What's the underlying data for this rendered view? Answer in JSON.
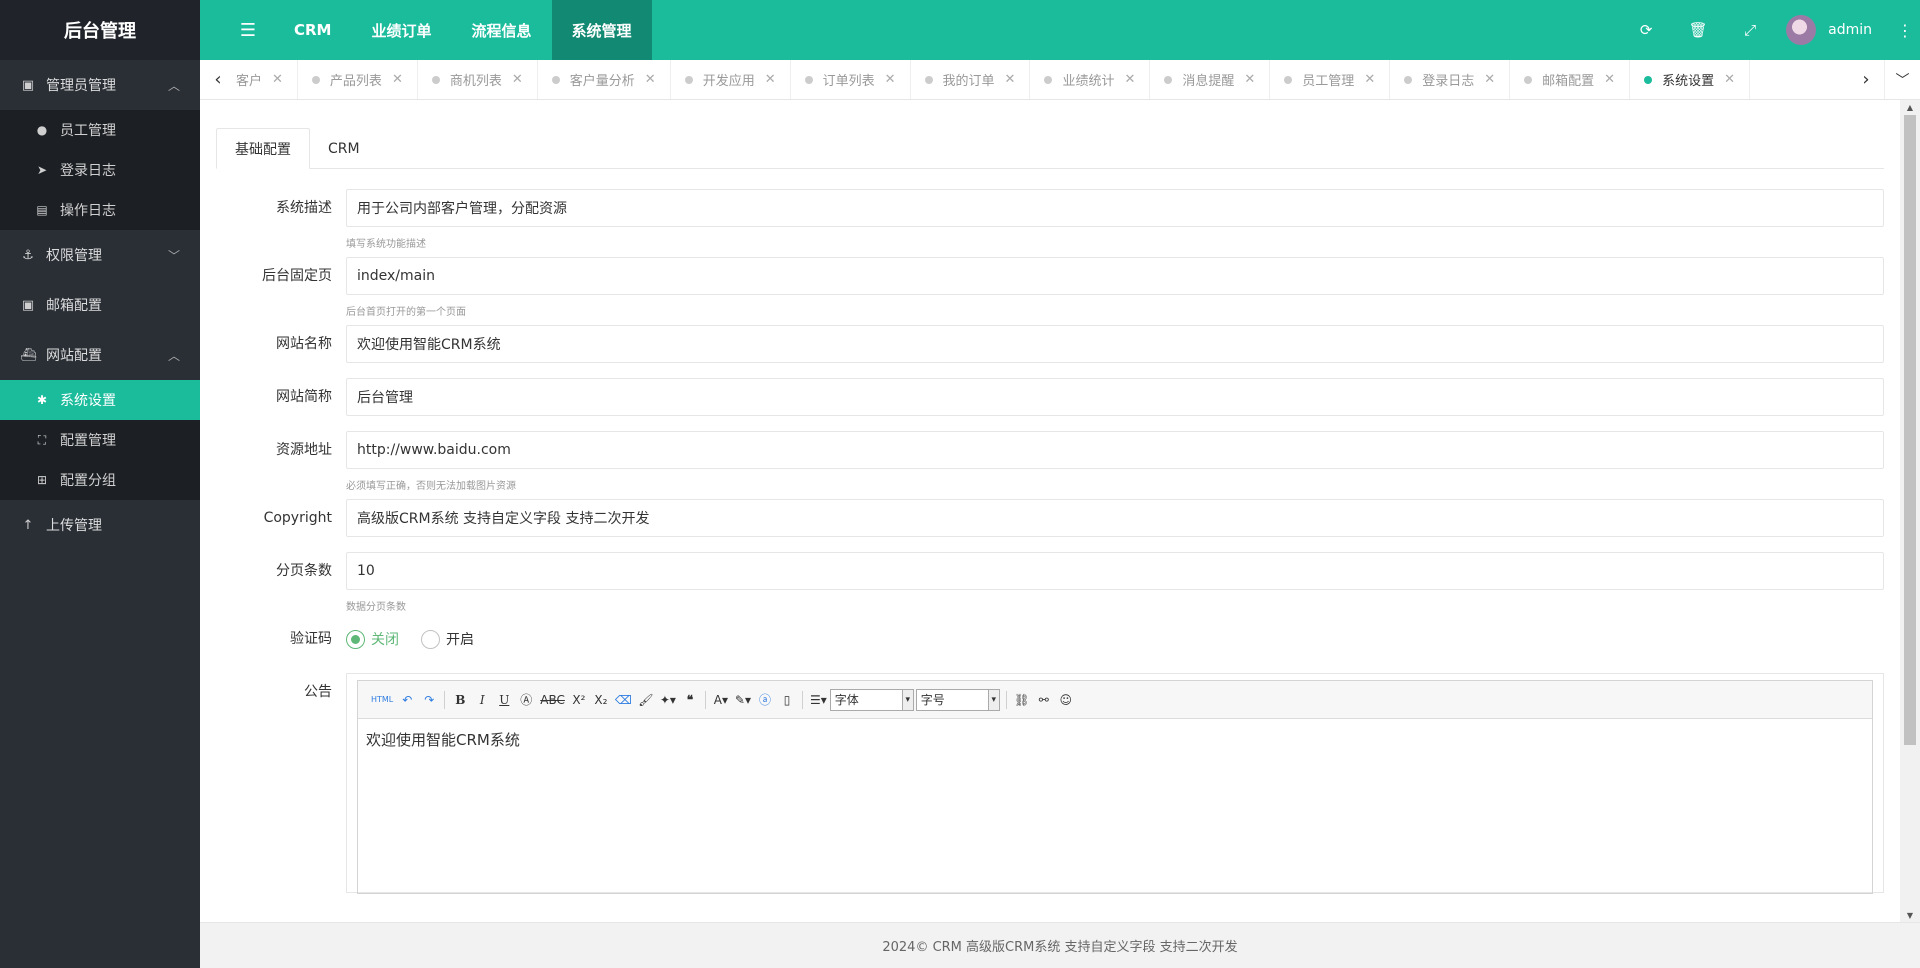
{
  "sidebar": {
    "logo": "后台管理",
    "groups": [
      {
        "label": "管理员管理",
        "icon": "admin-icon",
        "items": [
          {
            "label": "员工管理",
            "icon": "user-icon"
          },
          {
            "label": "登录日志",
            "icon": "paper-plane-icon"
          },
          {
            "label": "操作日志",
            "icon": "list-icon"
          }
        ]
      },
      {
        "label": "权限管理",
        "icon": "anchor-icon"
      },
      {
        "label": "邮箱配置",
        "icon": "mail-icon"
      },
      {
        "label": "网站配置",
        "icon": "ship-icon",
        "items": [
          {
            "label": "系统设置",
            "icon": "gear-icon",
            "active": true
          },
          {
            "label": "配置管理",
            "icon": "frame-icon"
          },
          {
            "label": "配置分组",
            "icon": "group-icon"
          }
        ]
      },
      {
        "label": "上传管理",
        "icon": "upload-icon"
      }
    ]
  },
  "topbar": {
    "nav": [
      "CRM",
      "业绩订单",
      "流程信息",
      "系统管理"
    ],
    "active_nav": "系统管理",
    "username": "admin"
  },
  "tabs": [
    "客户",
    "产品列表",
    "商机列表",
    "客户量分析",
    "开发应用",
    "订单列表",
    "我的订单",
    "业绩统计",
    "消息提醒",
    "员工管理",
    "登录日志",
    "邮箱配置",
    "系统设置"
  ],
  "active_tab": "系统设置",
  "form_tabs": [
    "基础配置",
    "CRM"
  ],
  "form": {
    "desc_label": "系统描述",
    "desc_value": "用于公司内部客户管理，分配资源",
    "desc_help": "填写系统功能描述",
    "home_label": "后台固定页",
    "home_value": "index/main",
    "home_help": "后台首页打开的第一个页面",
    "site_name_label": "网站名称",
    "site_name_value": "欢迎使用智能CRM系统",
    "short_name_label": "网站简称",
    "short_name_value": "后台管理",
    "resource_label": "资源地址",
    "resource_value": "http://www.baidu.com",
    "resource_help": "必须填写正确，否则无法加载图片资源",
    "copyright_label": "Copyright",
    "copyright_value": "高级版CRM系统 支持自定义字段  支持二次开发",
    "page_size_label": "分页条数",
    "page_size_value": "10",
    "page_size_help": "数据分页条数",
    "captcha_label": "验证码",
    "captcha_off": "关闭",
    "captcha_on": "开启",
    "captcha_selected": "关闭",
    "notice_label": "公告",
    "editor": {
      "font_select": "字体",
      "size_select": "字号",
      "html_btn": "HTML",
      "content": "欢迎使用智能CRM系统"
    }
  },
  "footer": "2024© CRM 高级版CRM系统 支持自定义字段 支持二次开发",
  "colors": {
    "accent": "#1abc9c",
    "sidebar_bg": "#2a2f36",
    "radio_green": "#5fb878"
  }
}
